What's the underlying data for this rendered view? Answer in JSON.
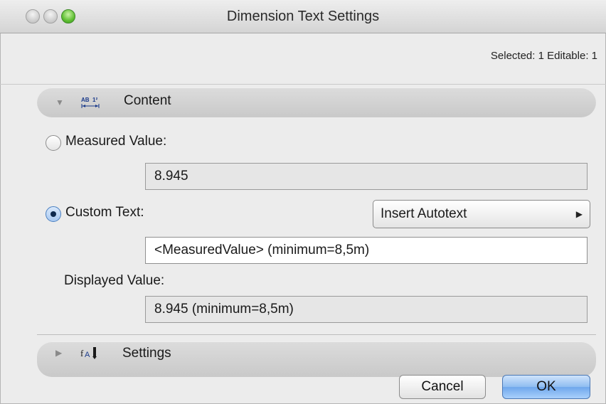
{
  "window": {
    "title": "Dimension Text Settings",
    "controls": [
      "close",
      "minimize",
      "zoom"
    ]
  },
  "selection_info": "Selected: 1 Editable: 1",
  "content_panel": {
    "label": "Content",
    "expanded": true,
    "icon": "dimension-text-icon",
    "measured_value": {
      "label": "Measured Value:",
      "checked": false,
      "value": "8.945"
    },
    "custom_text": {
      "label": "Custom Text:",
      "checked": true,
      "value": "<MeasuredValue> (minimum=8,5m)",
      "autotext_button": "Insert Autotext"
    },
    "displayed_value": {
      "label": "Displayed Value:",
      "value": "8.945 (minimum=8,5m)"
    }
  },
  "settings_panel": {
    "label": "Settings",
    "expanded": false,
    "icon": "text-settings-icon"
  },
  "buttons": {
    "cancel": "Cancel",
    "ok": "OK"
  }
}
